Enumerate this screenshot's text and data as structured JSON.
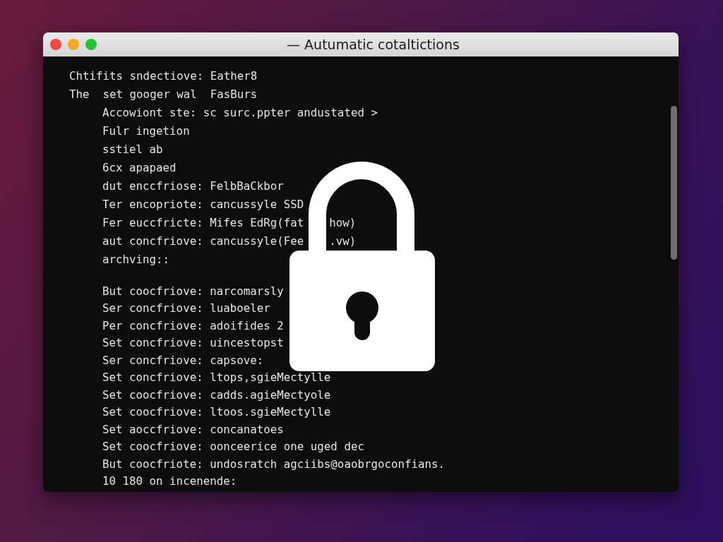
{
  "window": {
    "title": "— Autumatic cotaltictions"
  },
  "terminal": {
    "sections": [
      {
        "lines": [
          {
            "kind": "top",
            "text": "Chtifits sndectiove: Eather8"
          },
          {
            "kind": "top",
            "text": "The  set googer wal  FasBurs"
          },
          {
            "kind": "indented",
            "text": "Accowiont ste: sc surc.ppter andustated >"
          },
          {
            "kind": "indented",
            "text": "Fulr ingetion"
          },
          {
            "kind": "indented",
            "text": "sstiel ab"
          },
          {
            "kind": "indented",
            "text": "6cx apapaed"
          },
          {
            "kind": "indented",
            "text": "dut enccfriose: FelbBaCkbor"
          },
          {
            "kind": "indented",
            "text": "Ter encopriote: cancussyle SSD"
          },
          {
            "kind": "indented",
            "text": "Fer euccfricte: Mifes EdRg(fat",
            "text_after": "how)"
          },
          {
            "kind": "indented",
            "text": "aut concfriove: cancussyle(Fee",
            "text_after": ".vw)"
          },
          {
            "kind": "indented",
            "text": "archving::"
          }
        ]
      },
      {
        "lines": [
          {
            "kind": "indented",
            "text": "But coocfriove: narcomarsly"
          },
          {
            "kind": "indented",
            "text": "Ser concfriove: luaboeler"
          },
          {
            "kind": "indented",
            "text": "Per concfriove: adoifides 2"
          },
          {
            "kind": "indented",
            "text": "Set concfriove: uincestopst"
          },
          {
            "kind": "indented",
            "text": "Ser concfriove: capsove:"
          },
          {
            "kind": "indented",
            "text": "Set concfriove: ltops,sgieMectylle"
          },
          {
            "kind": "indented",
            "text": "Set coocfriove: cadds.agieMectyole"
          },
          {
            "kind": "indented",
            "text": "Set coocfriove: ltoos.sgieMectylle"
          },
          {
            "kind": "indented",
            "text": "Set aoccfriove: concanatoes"
          },
          {
            "kind": "indented",
            "text": "Set coocfriove: oonceerice one uged dec"
          },
          {
            "kind": "indented",
            "text": "But coocfriote: undosratch agciibs@oaobrgoconfians."
          },
          {
            "kind": "indented",
            "text": "10 180 on incenende:"
          }
        ]
      }
    ]
  }
}
